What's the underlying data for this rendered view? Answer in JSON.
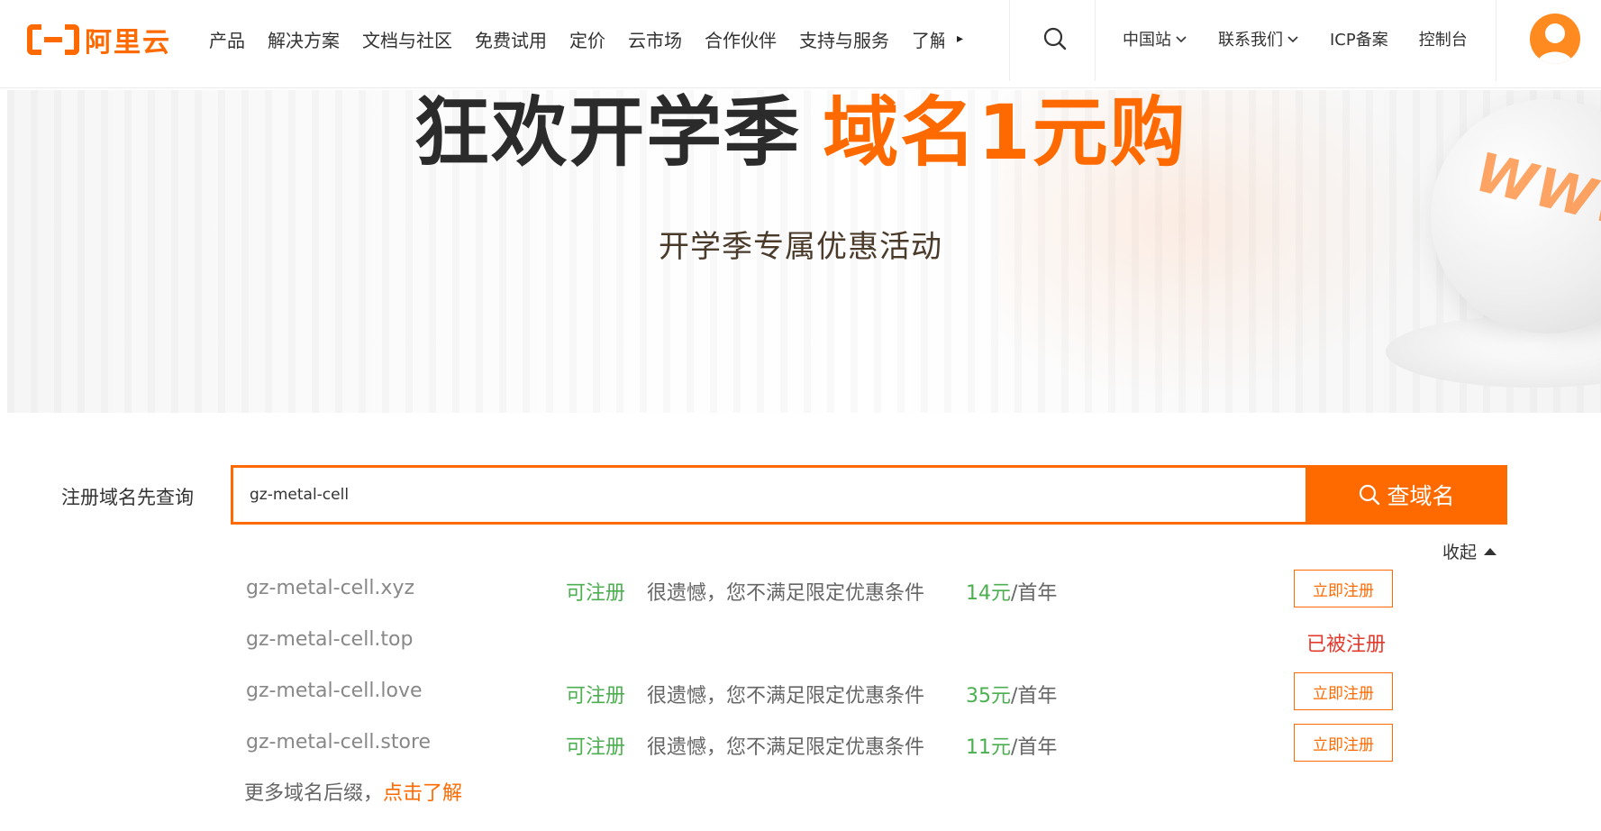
{
  "header": {
    "logo_text": "阿里云",
    "nav": [
      "产品",
      "解决方案",
      "文档与社区",
      "免费试用",
      "定价",
      "云市场",
      "合作伙伴",
      "支持与服务"
    ],
    "nav_clipped": "了解",
    "more_arrow": "▸",
    "right_links": {
      "site": "中国站",
      "contact": "联系我们",
      "icp": "ICP备案",
      "console": "控制台"
    }
  },
  "banner": {
    "title_dark": "狂欢开学季",
    "title_orange": "域名1元购",
    "subtitle": "开学季专属优惠活动",
    "globe_text": "WWW"
  },
  "search": {
    "label": "注册域名先查询",
    "value": "gz-metal-cell",
    "button_label": "查域名",
    "collapse_label": "收起"
  },
  "results": [
    {
      "domain": "gz-metal-cell.xyz",
      "status": "可注册",
      "note": "很遗憾，您不满足限定优惠条件",
      "price": "14元",
      "unit": "/首年",
      "action": "立即注册"
    },
    {
      "domain": "gz-metal-cell.top",
      "taken": "已被注册"
    },
    {
      "domain": "gz-metal-cell.love",
      "status": "可注册",
      "note": "很遗憾，您不满足限定优惠条件",
      "price": "35元",
      "unit": "/首年",
      "action": "立即注册"
    },
    {
      "domain": "gz-metal-cell.store",
      "status": "可注册",
      "note": "很遗憾，您不满足限定优惠条件",
      "price": "11元",
      "unit": "/首年",
      "action": "立即注册"
    }
  ],
  "more": {
    "text": "更多域名后缀，",
    "link": "点击了解"
  },
  "colors": {
    "brand": "#ff6a00",
    "available": "#4caf50",
    "taken": "#e23b2e"
  }
}
